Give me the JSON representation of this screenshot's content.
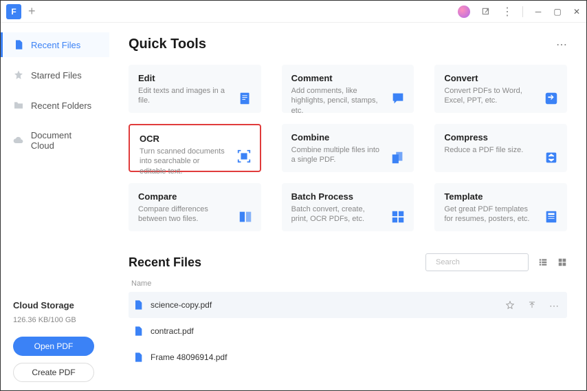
{
  "titlebar": {
    "plus": "+",
    "more": "⋮"
  },
  "sidebar": {
    "items": [
      {
        "label": "Recent Files",
        "active": true
      },
      {
        "label": "Starred Files",
        "active": false
      },
      {
        "label": "Recent Folders",
        "active": false
      },
      {
        "label": "Document Cloud",
        "active": false
      }
    ],
    "cloud": {
      "title": "Cloud Storage",
      "usage": "126.36 KB/100 GB"
    },
    "open_btn": "Open PDF",
    "create_btn": "Create PDF"
  },
  "quick_tools": {
    "heading": "Quick Tools",
    "more": "⋯",
    "cards": [
      {
        "title": "Edit",
        "desc": "Edit texts and images in a file."
      },
      {
        "title": "Comment",
        "desc": "Add comments, like highlights, pencil, stamps, etc."
      },
      {
        "title": "Convert",
        "desc": "Convert PDFs to Word, Excel, PPT, etc."
      },
      {
        "title": "OCR",
        "desc": "Turn scanned documents into searchable or editable text."
      },
      {
        "title": "Combine",
        "desc": "Combine multiple files into a single PDF."
      },
      {
        "title": "Compress",
        "desc": "Reduce a PDF file size."
      },
      {
        "title": "Compare",
        "desc": "Compare differences between two files."
      },
      {
        "title": "Batch Process",
        "desc": "Batch convert, create, print, OCR PDFs, etc."
      },
      {
        "title": "Template",
        "desc": "Get great PDF templates for resumes, posters, etc."
      }
    ]
  },
  "recent": {
    "heading": "Recent Files",
    "search_ph": "Search",
    "col_name": "Name",
    "files": [
      {
        "name": "science-copy.pdf",
        "hover": true
      },
      {
        "name": "contract.pdf",
        "hover": false
      },
      {
        "name": "Frame 48096914.pdf",
        "hover": false
      }
    ]
  }
}
